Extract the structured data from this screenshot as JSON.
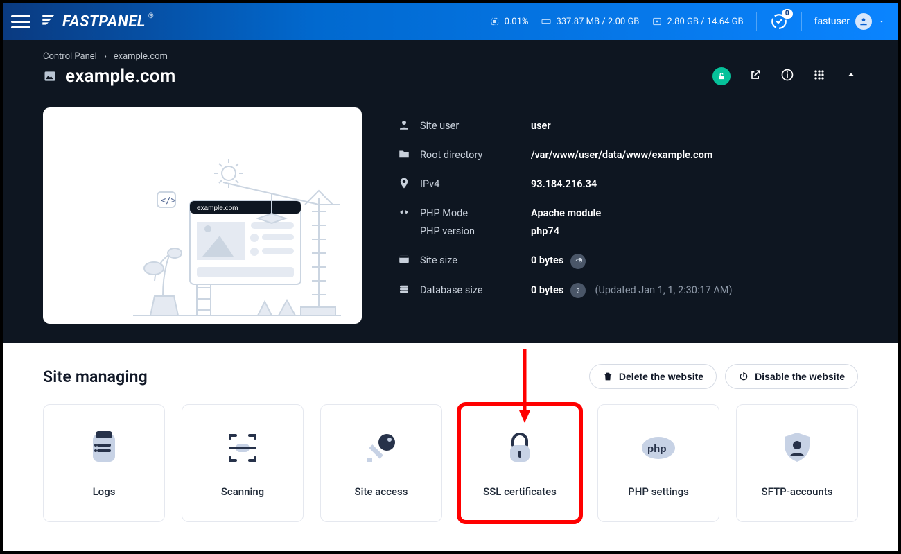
{
  "header": {
    "logo_text": "FASTPANEL",
    "cpu": "0.01%",
    "ram": "337.87 MB / 2.00 GB",
    "disk": "2.80 GB / 14.64 GB",
    "notif_count": "0",
    "username": "fastuser"
  },
  "breadcrumb": {
    "root": "Control Panel",
    "current": "example.com"
  },
  "page": {
    "title": "example.com"
  },
  "meta": {
    "site_user_label": "Site user",
    "site_user": "user",
    "root_label": "Root directory",
    "root": "/var/www/user/data/www/example.com",
    "ip_label": "IPv4",
    "ip": "93.184.216.34",
    "php_mode_label": "PHP Mode",
    "php_mode": "Apache module",
    "php_version_label": "PHP version",
    "php_version": "php74",
    "site_size_label": "Site size",
    "site_size": "0 bytes",
    "db_size_label": "Database size",
    "db_size": "0 bytes",
    "db_updated": "(Updated Jan 1, 1, 2:30:17 AM)"
  },
  "thumb": {
    "url_text": "example.com"
  },
  "section": {
    "title": "Site managing",
    "delete": "Delete the website",
    "disable": "Disable the website"
  },
  "cards": {
    "logs": "Logs",
    "scanning": "Scanning",
    "site_access": "Site access",
    "ssl": "SSL certificates",
    "php": "PHP settings",
    "sftp": "SFTP-accounts"
  }
}
